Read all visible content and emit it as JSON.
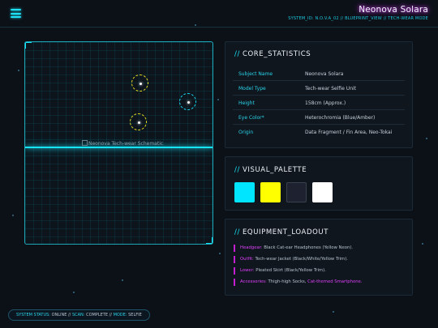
{
  "header": {
    "title": "Neonova Solara",
    "subtitle": "SYSTEM_ID: N.O.V.A_02 // BLUEPRINT_VIEW // TECH-WEAR MODE"
  },
  "schematic": {
    "image_alt": "Neonova Tech-wear Schematic"
  },
  "core_statistics": {
    "title": "CORE_STATISTICS",
    "rows": [
      {
        "label": "Subject Name",
        "value": "Neonova Solara"
      },
      {
        "label": "Model Type",
        "value": "Tech-wear Selfie Unit"
      },
      {
        "label": "Height",
        "value": "158cm (Approx.)"
      },
      {
        "label": "Eye Color*",
        "value": "Heterochromia (Blue/Amber)"
      },
      {
        "label": "Origin",
        "value": "Data Fragment / Fin Area, Neo-Tokai"
      }
    ]
  },
  "visual_palette": {
    "title": "VISUAL_PALETTE",
    "swatches": [
      "#00e5ff",
      "#ffff00",
      "#1e2230",
      "#ffffff"
    ]
  },
  "equipment_loadout": {
    "title": "EQUIPMENT_LOADOUT",
    "items": [
      {
        "label": "Headgear:",
        "value": "Black Cat-ear Headphones (Yellow Neon)."
      },
      {
        "label": "Outfit:",
        "value": "Tech-wear Jacket (Black/White/Yellow Trim)."
      },
      {
        "label": "Lower:",
        "value": "Pleated Skirt (Black/Yellow Trim)."
      },
      {
        "label": "Accessories:",
        "value": "Thigh-high Socks, ",
        "highlight": "Cat-themed Smartphone."
      }
    ]
  },
  "status_bar": {
    "system_status_label": "SYSTEM STATUS:",
    "system_status_value": "ONLINE",
    "scan_label": "SCAN:",
    "scan_value": "COMPLETE",
    "mode_label": "MODE:",
    "mode_value": "SELFIE",
    "separator": "//"
  },
  "colors": {
    "accent_cyan": "#18e4f8",
    "accent_magenta": "#e040fb",
    "marker_yellow": "#e8e020",
    "background": "#0c1118"
  }
}
